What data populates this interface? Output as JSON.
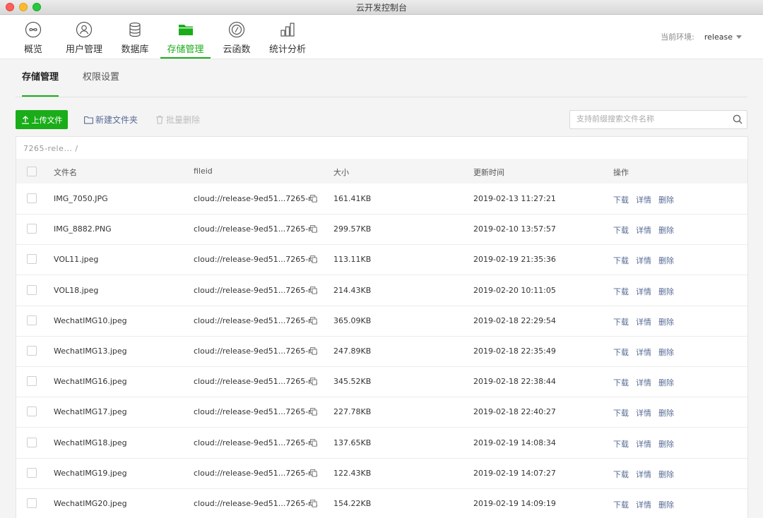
{
  "window": {
    "title": "云开发控制台"
  },
  "nav": {
    "items": [
      {
        "label": "概览",
        "icon": "infinity-icon"
      },
      {
        "label": "用户管理",
        "icon": "user-icon"
      },
      {
        "label": "数据库",
        "icon": "database-icon"
      },
      {
        "label": "存储管理",
        "icon": "folder-icon",
        "active": true
      },
      {
        "label": "云函数",
        "icon": "function-icon"
      },
      {
        "label": "统计分析",
        "icon": "bar-chart-icon"
      }
    ],
    "env_label": "当前环境:",
    "env_value": "release"
  },
  "subtabs": [
    {
      "label": "存储管理",
      "active": true
    },
    {
      "label": "权限设置"
    }
  ],
  "toolbar": {
    "upload_label": "上传文件",
    "new_folder_label": "新建文件夹",
    "batch_delete_label": "批量删除",
    "search_placeholder": "支持前缀搜索文件名称"
  },
  "breadcrumb": "7265-rele... /",
  "table": {
    "columns": {
      "name": "文件名",
      "fileid": "fileid",
      "size": "大小",
      "time": "更新时间",
      "ops": "操作"
    },
    "actions": {
      "download": "下载",
      "details": "详情",
      "delete": "删除"
    },
    "rows": [
      {
        "name": "IMG_7050.JPG",
        "fileid": "cloud://release-9ed51...7265-r...",
        "size": "161.41KB",
        "time": "2019-02-13 11:27:21"
      },
      {
        "name": "IMG_8882.PNG",
        "fileid": "cloud://release-9ed51...7265-r...",
        "size": "299.57KB",
        "time": "2019-02-10 13:57:57"
      },
      {
        "name": "VOL11.jpeg",
        "fileid": "cloud://release-9ed51...7265-r...",
        "size": "113.11KB",
        "time": "2019-02-19 21:35:36"
      },
      {
        "name": "VOL18.jpeg",
        "fileid": "cloud://release-9ed51...7265-r...",
        "size": "214.43KB",
        "time": "2019-02-20 10:11:05"
      },
      {
        "name": "WechatIMG10.jpeg",
        "fileid": "cloud://release-9ed51...7265-r...",
        "size": "365.09KB",
        "time": "2019-02-18 22:29:54"
      },
      {
        "name": "WechatIMG13.jpeg",
        "fileid": "cloud://release-9ed51...7265-r...",
        "size": "247.89KB",
        "time": "2019-02-18 22:35:49"
      },
      {
        "name": "WechatIMG16.jpeg",
        "fileid": "cloud://release-9ed51...7265-r...",
        "size": "345.52KB",
        "time": "2019-02-18 22:38:44"
      },
      {
        "name": "WechatIMG17.jpeg",
        "fileid": "cloud://release-9ed51...7265-r...",
        "size": "227.78KB",
        "time": "2019-02-18 22:40:27"
      },
      {
        "name": "WechatIMG18.jpeg",
        "fileid": "cloud://release-9ed51...7265-r...",
        "size": "137.65KB",
        "time": "2019-02-19 14:08:34"
      },
      {
        "name": "WechatIMG19.jpeg",
        "fileid": "cloud://release-9ed51...7265-r...",
        "size": "122.43KB",
        "time": "2019-02-19 14:07:27"
      },
      {
        "name": "WechatIMG20.jpeg",
        "fileid": "cloud://release-9ed51...7265-r...",
        "size": "154.22KB",
        "time": "2019-02-19 14:09:19"
      }
    ]
  }
}
